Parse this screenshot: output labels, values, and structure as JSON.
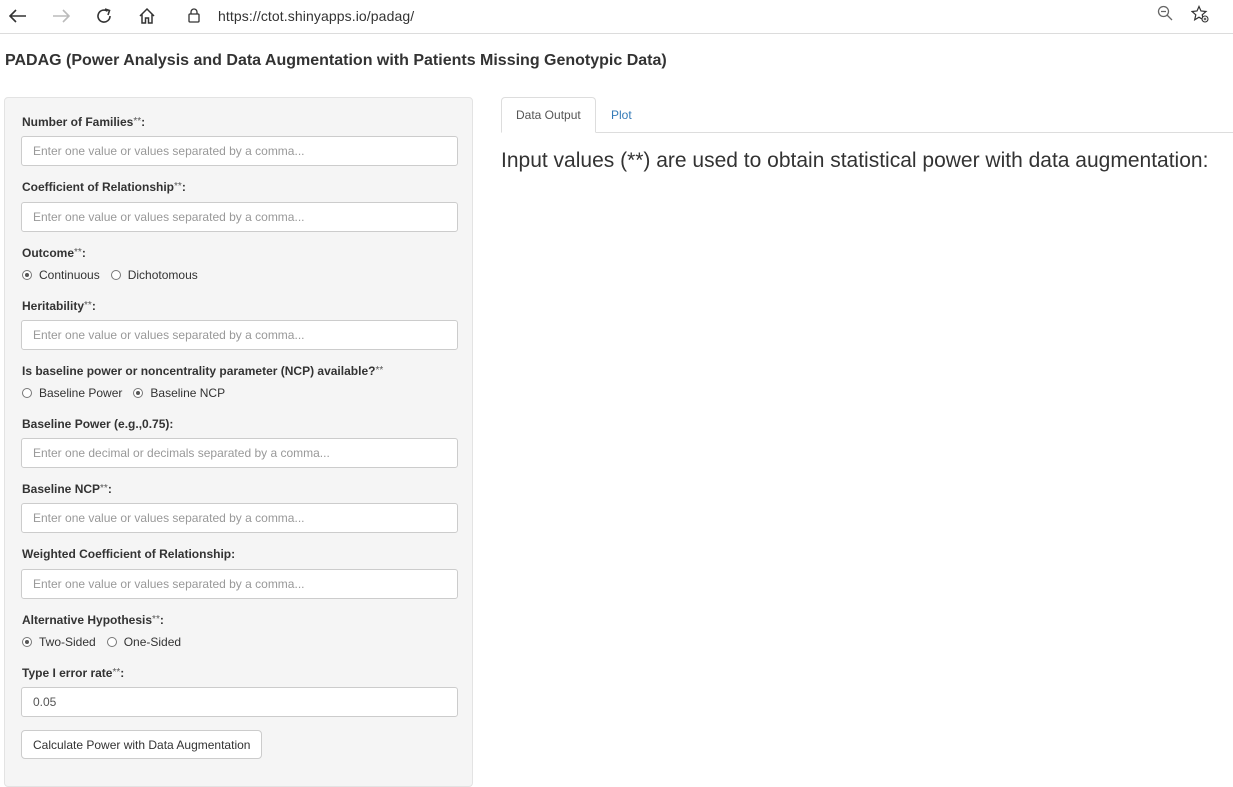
{
  "browser": {
    "url": "https://ctot.shinyapps.io/padag/"
  },
  "app": {
    "title": "PADAG (Power Analysis and Data Augmentation with Patients Missing Genotypic Data)"
  },
  "form": {
    "num_families": {
      "label": "Number of Families",
      "req": "**",
      "placeholder": "Enter one value or values separated by a comma..."
    },
    "coef_relationship": {
      "label": "Coefficient of Relationship",
      "req": "**",
      "placeholder": "Enter one value or values separated by a comma..."
    },
    "outcome": {
      "label": "Outcome",
      "req": "**",
      "options": [
        "Continuous",
        "Dichotomous"
      ],
      "selected": "Continuous"
    },
    "heritability": {
      "label": "Heritability",
      "req": "**",
      "placeholder": "Enter one value or values separated by a comma..."
    },
    "baseline_choice": {
      "label": "Is baseline power or noncentrality parameter (NCP) available?",
      "req": "**",
      "options": [
        "Baseline Power",
        "Baseline NCP"
      ],
      "selected": "Baseline NCP"
    },
    "baseline_power": {
      "label": "Baseline Power (e.g.,0.75):",
      "placeholder": "Enter one decimal or decimals separated by a comma..."
    },
    "baseline_ncp": {
      "label": "Baseline NCP",
      "req": "**",
      "placeholder": "Enter one value or values separated by a comma..."
    },
    "weighted_coef": {
      "label": "Weighted Coefficient of Relationship:",
      "placeholder": "Enter one value or values separated by a comma..."
    },
    "alt_hypothesis": {
      "label": "Alternative Hypothesis",
      "req": "**",
      "options": [
        "Two-Sided",
        "One-Sided"
      ],
      "selected": "Two-Sided"
    },
    "type1_error": {
      "label": "Type I error rate",
      "req": "**",
      "value": "0.05"
    },
    "calculate_label": "Calculate Power with Data Augmentation"
  },
  "tabs": {
    "data_output": "Data Output",
    "plot": "Plot"
  },
  "main": {
    "message": "Input values (**) are used to obtain statistical power with data augmentation:"
  }
}
